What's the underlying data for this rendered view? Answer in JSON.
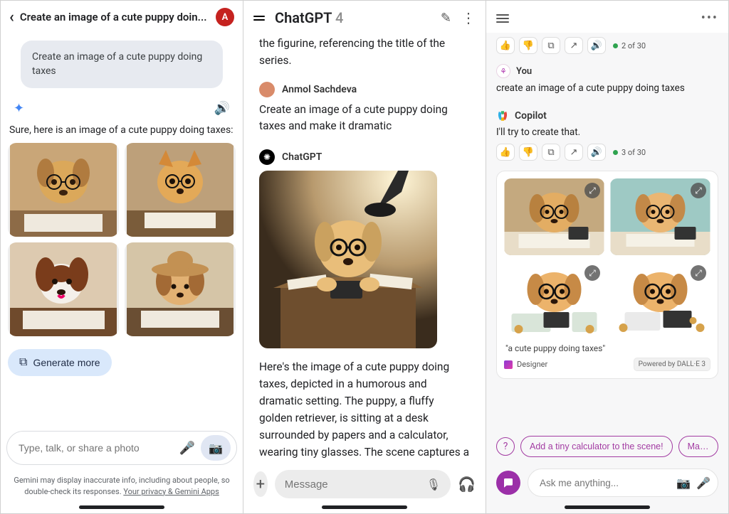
{
  "panel1": {
    "header_title": "Create an image of a cute puppy doin...",
    "avatar_initial": "A",
    "user_prompt": "Create an image of a cute puppy doing taxes",
    "intro": "Sure, here is an image of a cute puppy doing taxes:",
    "generate_more": "Generate more",
    "input_placeholder": "Type, talk, or share a photo",
    "disclaimer_pre": "Gemini may display inaccurate info, including about people, so double-check its responses. ",
    "disclaimer_link": "Your privacy & Gemini Apps"
  },
  "panel2": {
    "app_name": "ChatGPT",
    "app_version": "4",
    "fragment": "the figurine, referencing the title of the series.",
    "user_name": "Anmol Sachdeva",
    "user_msg": "Create an image of a cute puppy doing taxes and make it dramatic",
    "bot_name": "ChatGPT",
    "bot_desc": "Here's the image of a cute puppy doing taxes, depicted in a humorous and dramatic setting. The puppy, a fluffy golden retriever, is sitting at a desk surrounded by papers and a calculator, wearing tiny glasses. The scene captures a mix of confusion and determination, enhanced by dramatic lighting.",
    "input_placeholder": "Message"
  },
  "panel3": {
    "counter1": "2 of 30",
    "you_label": "You",
    "you_msg": "create an image of a cute puppy doing taxes",
    "copilot_label": "Copilot",
    "copilot_msg": "I'll try to create that.",
    "counter2": "3 of 30",
    "caption": "\"a cute puppy doing taxes\"",
    "designer_label": "Designer",
    "powered_by": "Powered by DALL·E 3",
    "suggestion1": "Add a tiny calculator to the scene!",
    "suggestion2": "Make the puppy w",
    "input_placeholder": "Ask me anything..."
  }
}
